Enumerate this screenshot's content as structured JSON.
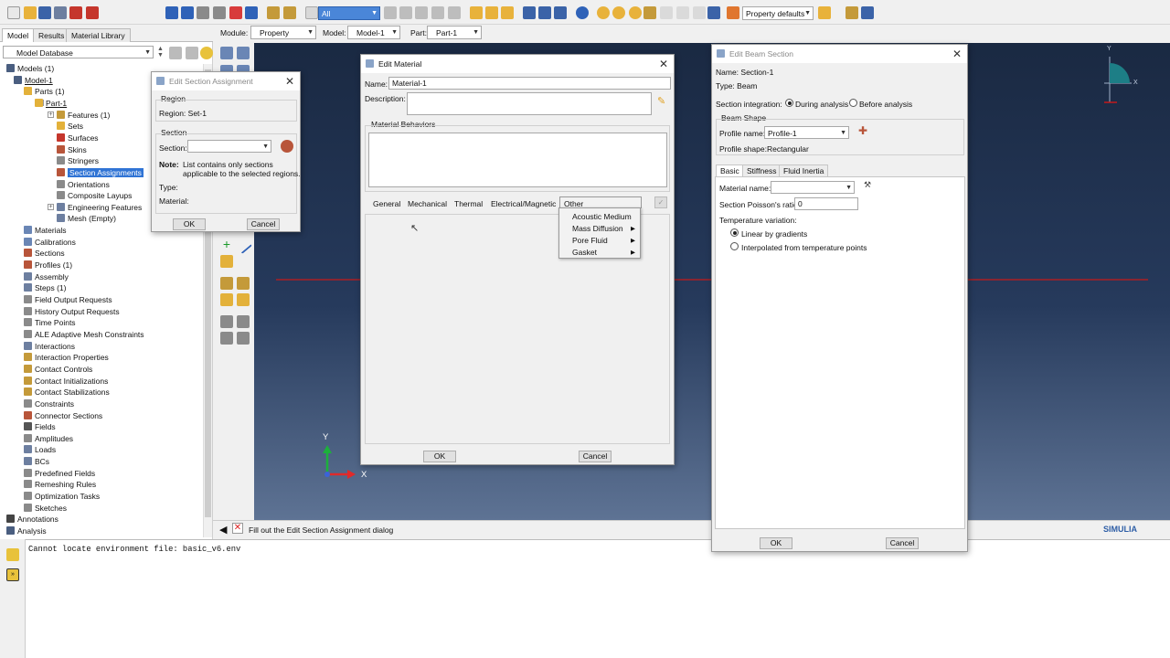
{
  "colors": {
    "accent": "#3074d5",
    "viewport_top": "#1a2942",
    "viewport_bottom": "#5e7394",
    "axis_red": "#e02a2a",
    "axis_green": "#1db03c",
    "edge_red": "#c51a1a"
  },
  "toolbar": {
    "selection_filter": "All",
    "render_style": "Property defaults"
  },
  "context": {
    "module_label": "Module:",
    "module_value": "Property",
    "model_label": "Model:",
    "model_value": "Model-1",
    "part_label": "Part:",
    "part_value": "Part-1"
  },
  "tabs": [
    "Model",
    "Results",
    "Material Library"
  ],
  "tree": {
    "db_label": "Model Database",
    "items": [
      "Models (1)",
      "Model-1",
      "Parts (1)",
      "Part-1",
      "Features (1)",
      "Sets",
      "Surfaces",
      "Skins",
      "Stringers",
      "Section Assignments",
      "Orientations",
      "Composite Layups",
      "Engineering Features",
      "Mesh (Empty)",
      "Materials",
      "Calibrations",
      "Sections",
      "Profiles (1)",
      "Assembly",
      "Steps (1)",
      "Field Output Requests",
      "History Output Requests",
      "Time Points",
      "ALE Adaptive Mesh Constraints",
      "Interactions",
      "Interaction Properties",
      "Contact Controls",
      "Contact Initializations",
      "Contact Stabilizations",
      "Constraints",
      "Connector Sections",
      "Fields",
      "Amplitudes",
      "Loads",
      "BCs",
      "Predefined Fields",
      "Remeshing Rules",
      "Optimization Tasks",
      "Sketches",
      "Annotations",
      "Analysis"
    ]
  },
  "viewport": {
    "triad_y": "Y",
    "triad_x": "X",
    "mini_y": "Y",
    "mini_x": "X",
    "brand": "SIMULIA"
  },
  "prompt": {
    "text": "Fill out the Edit Section Assignment dialog"
  },
  "messages": {
    "line1": "Cannot locate environment file:  basic_v6.env"
  },
  "section_assignment": {
    "title": "Edit Section Assignment",
    "region_group": "Region",
    "region_line": "Region:  Set-1",
    "section_group": "Section",
    "section_label": "Section:",
    "note_label": "Note:",
    "note_text_1": "List contains only sections",
    "note_text_2": "applicable to the selected regions.",
    "type_label": "Type:",
    "material_label": "Material:",
    "ok": "OK",
    "cancel": "Cancel"
  },
  "edit_material": {
    "title": "Edit Material",
    "name_label": "Name:",
    "name_value": "Material-1",
    "description_label": "Description:",
    "behaviors_label": "Material Behaviors",
    "menus": [
      "General",
      "Mechanical",
      "Thermal",
      "Electrical/Magnetic",
      "Other"
    ],
    "other_menu": [
      "Acoustic Medium",
      "Mass Diffusion",
      "Pore Fluid",
      "Gasket"
    ],
    "ok": "OK",
    "cancel": "Cancel"
  },
  "beam_section": {
    "title": "Edit Beam Section",
    "name_line": "Name:  Section-1",
    "type_line": "Type:   Beam",
    "integration_label": "Section integration:",
    "during": "During analysis",
    "before": "Before analysis",
    "beam_shape": "Beam Shape",
    "profile_name_label": "Profile name:",
    "profile_name_value": "Profile-1",
    "profile_shape_label": "Profile shape:",
    "profile_shape_value": "Rectangular",
    "tabs": [
      "Basic",
      "Stiffness",
      "Fluid Inertia"
    ],
    "material_name_label": "Material name:",
    "poisson_label": "Section Poisson's ratio:",
    "poisson_value": "0",
    "temp_label": "Temperature variation:",
    "linear": "Linear by gradients",
    "interp": "Interpolated from temperature points",
    "ok": "OK",
    "cancel": "Cancel"
  }
}
